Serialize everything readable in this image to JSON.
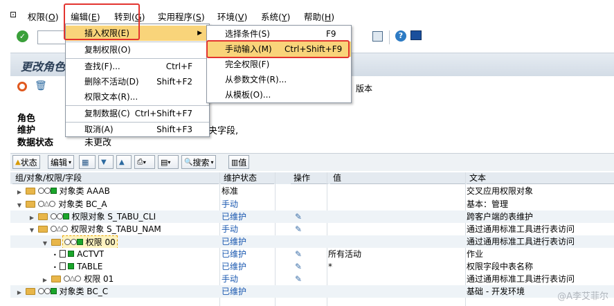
{
  "menubar": {
    "items": [
      {
        "label": "权限(",
        "key": "O",
        "tail": ")"
      },
      {
        "label": "编辑(",
        "key": "E",
        "tail": ")"
      },
      {
        "label": "转到(",
        "key": "G",
        "tail": ")"
      },
      {
        "label": "实用程序(",
        "key": "S",
        "tail": ")"
      },
      {
        "label": "环境(",
        "key": "V",
        "tail": ")"
      },
      {
        "label": "系统(",
        "key": "Y",
        "tail": ")"
      },
      {
        "label": "帮助(",
        "key": "H",
        "tail": ")"
      }
    ]
  },
  "title": "更改角色",
  "app_toolbar": {
    "version_label": "版本"
  },
  "info": {
    "role_label": "角色",
    "maintain_label": "维护",
    "maintain_value": "…夬字段,",
    "status_label": "数据状态",
    "status_value": "未更改"
  },
  "grid_toolbar": {
    "status_btn": "状态",
    "edit_btn": "编辑",
    "search_btn": "搜索",
    "value_btn": "值"
  },
  "columns": [
    "组/对象/权限/字段",
    "维护状态",
    "操作",
    "值",
    "文本"
  ],
  "rows": [
    {
      "name": "对象类 AAAB",
      "status": "标准",
      "value": "",
      "text": "交叉应用权限对象"
    },
    {
      "name": "对象类 BC_A",
      "status": "手动",
      "value": "",
      "text": "基本：管理"
    },
    {
      "name": "权限对象 S_TABU_CLI",
      "status": "已维护",
      "value": "",
      "text": "跨客户端的表维护"
    },
    {
      "name": "权限对象 S_TABU_NAM",
      "status": "手动",
      "value": "",
      "text": "通过通用标准工具进行表访问"
    },
    {
      "name": "权限 00",
      "status": "已维护",
      "value": "",
      "text": "通过通用标准工具进行表访问"
    },
    {
      "name": "ACTVT",
      "status": "已维护",
      "value": "所有活动",
      "text": "作业"
    },
    {
      "name": "TABLE",
      "status": "已维护",
      "value": "*",
      "text": "权限字段中表名称"
    },
    {
      "name": "权限 01",
      "status": "手动",
      "value": "",
      "text": "通过通用标准工具进行表访问"
    },
    {
      "name": "对象类 BC_C",
      "status": "已维护",
      "value": "",
      "text": "基础 - 开发环境"
    }
  ],
  "edit_menu": {
    "items": [
      {
        "label": "插入权限(E)",
        "accel": "",
        "submenu": true
      },
      {
        "label": "复制权限(O)",
        "accel": ""
      },
      {
        "label": "查找(F)...",
        "accel": "Ctrl+F"
      },
      {
        "label": "删除不活动(D)",
        "accel": "Shift+F2"
      },
      {
        "label": "权限文本(R)...",
        "accel": ""
      },
      {
        "label": "复制数据(C)",
        "accel": "Ctrl+Shift+F7"
      },
      {
        "label": "取消(A)",
        "accel": "Shift+F3"
      }
    ]
  },
  "insert_submenu": {
    "items": [
      {
        "label": "选择条件(S)",
        "accel": "F9"
      },
      {
        "label": "手动输入(M)",
        "accel": "Ctrl+Shift+F9"
      },
      {
        "label": "完全权限(F)",
        "accel": ""
      },
      {
        "label": "从参数文件(R)...",
        "accel": ""
      },
      {
        "label": "从模板(O)...",
        "accel": ""
      }
    ]
  },
  "watermark": "@A李艾菲尔",
  "colors": {
    "highlight": "#f9d47a",
    "annotation_red": "#e3342f",
    "title_text": "#2b3f57"
  }
}
